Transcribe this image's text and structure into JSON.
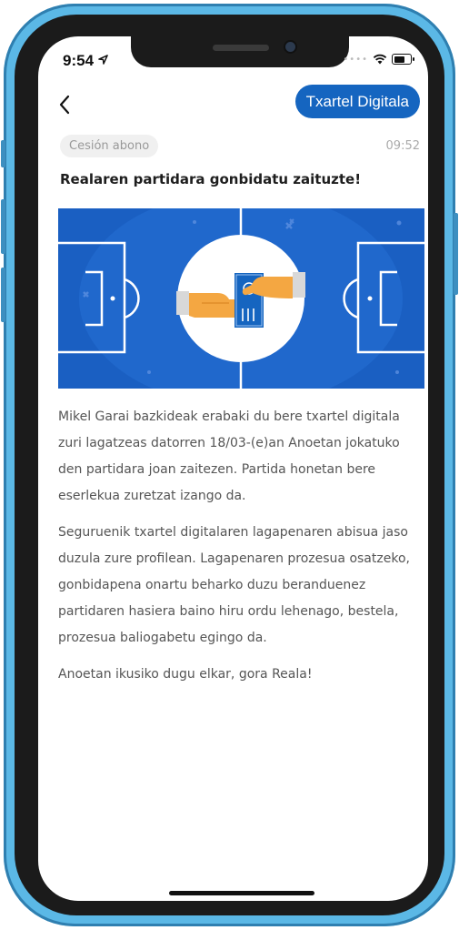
{
  "status": {
    "time": "9:54"
  },
  "header": {
    "digital_ticket_label": "Txartel Digitala"
  },
  "message": {
    "tag": "Cesión abono",
    "time": "09:52",
    "title": "Realaren partidara gonbidatu zaituzte!",
    "paragraphs": [
      "Mikel Garai bazkideak erabaki du bere txartel digitala zuri lagatzeas datorren 18/03-(e)an Anoetan jokatuko den partidara joan zaitezen. Partida honetan bere eserlekua zuretzat izango da.",
      "Seguruenik txartel digitalaren lagapenaren abisua jaso duzula zure profilean. Lagapenaren prozesua osatzeko, gonbidapena onartu beharko duzu beranduenez partidaren hasiera baino hiru ordu lehenago, bestela, prozesua baliogabetu egingo da.",
      "Anoetan ikusiko dugu elkar, gora Reala!"
    ]
  },
  "colors": {
    "accent": "#1565c0",
    "field": "#1a5fc2",
    "hand": "#f4a742",
    "frame": "#5bb8e6"
  }
}
